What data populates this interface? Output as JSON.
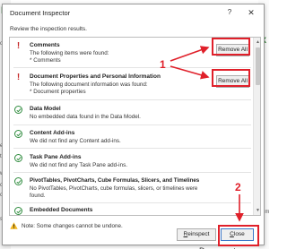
{
  "background": {
    "left_fragments": [
      "M",
      "op",
      "er",
      "t a",
      "w",
      "op",
      "ot",
      "se"
    ],
    "right_fragments": [
      "X",
      "y,",
      "y,",
      "cum"
    ],
    "bottom_right_text": "Related Documents"
  },
  "dialog": {
    "title": "Document Inspector",
    "help_label": "?",
    "close_glyph": "✕",
    "instructions": "Review the inspection results.",
    "items": [
      {
        "status": "warning",
        "heading": "Comments",
        "lines": [
          "The following items were found:",
          "* Comments"
        ],
        "action": "Remove All"
      },
      {
        "status": "warning",
        "heading": "Document Properties and Personal Information",
        "lines": [
          "The following document information was found:",
          "* Document properties"
        ],
        "action": "Remove All"
      },
      {
        "status": "ok",
        "heading": "Data Model",
        "lines": [
          "No embedded data found in the Data Model."
        ]
      },
      {
        "status": "ok",
        "heading": "Content Add-ins",
        "lines": [
          "We did not find any Content add-ins."
        ]
      },
      {
        "status": "ok",
        "heading": "Task Pane Add-ins",
        "lines": [
          "We did not find any Task Pane add-ins."
        ]
      },
      {
        "status": "ok",
        "heading": "PivotTables, PivotCharts, Cube Formulas, Slicers, and Timelines",
        "lines": [
          "No PivotTables, PivotCharts, cube formulas, slicers, or timelines were",
          "found."
        ]
      },
      {
        "status": "ok",
        "heading": "Embedded Documents",
        "lines": []
      }
    ],
    "note": "Note: Some changes cannot be undone.",
    "reinspect_label": "Reinspect",
    "close_label": "Close"
  },
  "annotations": {
    "callout_1": "1",
    "callout_2": "2",
    "color": "#e0202a"
  }
}
